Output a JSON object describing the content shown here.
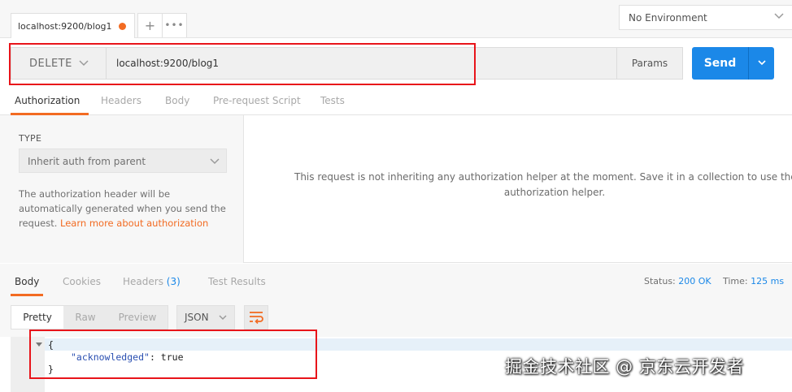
{
  "tabs": {
    "request_tab_label": "localhost:9200/blog1",
    "new_tab_icon": "+",
    "more_icon": "•••"
  },
  "environment": {
    "selected": "No Environment"
  },
  "request": {
    "method": "DELETE",
    "url": "localhost:9200/blog1",
    "params_label": "Params",
    "send_label": "Send"
  },
  "request_tabs": [
    "Authorization",
    "Headers",
    "Body",
    "Pre-request Script",
    "Tests"
  ],
  "auth": {
    "type_label": "TYPE",
    "type_value": "Inherit auth from parent",
    "help_text": "The authorization header will be automatically generated when you send the request.",
    "help_link": "Learn more about authorization",
    "message_line1": "This request is not inheriting any authorization helper at the moment. Save it in a collection to use the par",
    "message_line2": "authorization helper."
  },
  "response": {
    "tabs": {
      "body": "Body",
      "cookies": "Cookies",
      "headers": "Headers",
      "headers_count": "(3)",
      "test_results": "Test Results"
    },
    "status_label": "Status:",
    "status_value": "200 OK",
    "time_label": "Time:",
    "time_value": "125 ms",
    "view_modes": [
      "Pretty",
      "Raw",
      "Preview"
    ],
    "format": "JSON",
    "code": {
      "line1": "{",
      "key": "\"acknowledged\"",
      "sep": ": ",
      "value": "true",
      "line3": "}"
    }
  },
  "watermark": "掘金技术社区 @ 京东云开发者",
  "colors": {
    "accent_orange": "#f26b22",
    "send_blue": "#1b88e8",
    "annotation_red": "#e8141a"
  }
}
